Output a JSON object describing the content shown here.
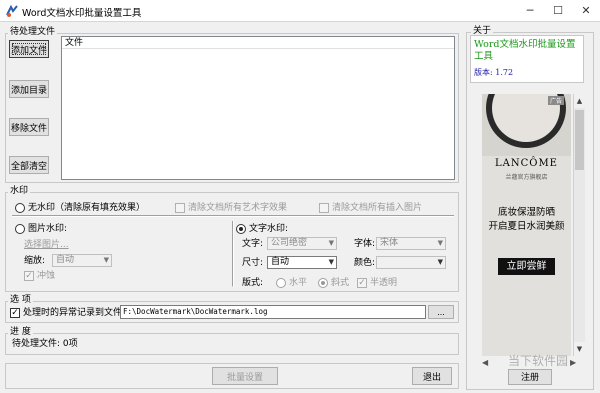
{
  "window": {
    "title": "Word文档水印批量设置工具",
    "minimize": "─",
    "maximize": "☐",
    "close": "✕"
  },
  "pending": {
    "group_label": "待处理文件",
    "list_header": "文件",
    "add_file": "添加文件",
    "add_dir": "添加目录",
    "remove_file": "移除文件",
    "clear_all": "全部清空"
  },
  "watermark": {
    "group_label": "水印",
    "none_label": "无水印（清除原有填充效果）",
    "clear_art": "清除文档所有艺术字效果",
    "clear_images": "清除文档所有插入图片",
    "image_label": "图片水印:",
    "choose_image": "选择图片...",
    "scale_label": "缩放:",
    "scale_value": "自动",
    "washout_label": "冲蚀",
    "text_label": "文字水印:",
    "text_field_label": "文字:",
    "text_value": "公司绝密",
    "font_label": "字体:",
    "font_value": "宋体",
    "size_label": "尺寸:",
    "size_value": "自动",
    "color_label": "颜色:",
    "layout_label": "版式:",
    "layout_horizontal": "水平",
    "layout_diagonal": "斜式",
    "semi_transparent": "半透明"
  },
  "options": {
    "group_label": "选  项",
    "log_label": "处理时的异常记录到文件:",
    "log_path": "F:\\DocWatermark\\DocWatermark.log",
    "browse": "..."
  },
  "progress": {
    "group_label": "进  度",
    "status": "待处理文件: 0项"
  },
  "footer": {
    "batch_button": "批量设置",
    "exit_button": "退出"
  },
  "about": {
    "group_label": "关于",
    "app_name": "Word文档水印批量设置工具",
    "version": "版本: 1.72",
    "register_button": "注册"
  },
  "ad": {
    "tag": "广告",
    "brand": "LANCÔME",
    "brand_sub": "兰蔻官方旗舰店",
    "line1": "底妆保湿防晒",
    "line2": "开启夏日水润美颜",
    "cta": "立即尝鲜",
    "watermark": "当下软件园"
  },
  "colors": {
    "app_name": "#1a9a1a",
    "version": "#1a1aa8",
    "ad_cta_bg": "#111111",
    "ad_bg": "#e2e0dc"
  }
}
